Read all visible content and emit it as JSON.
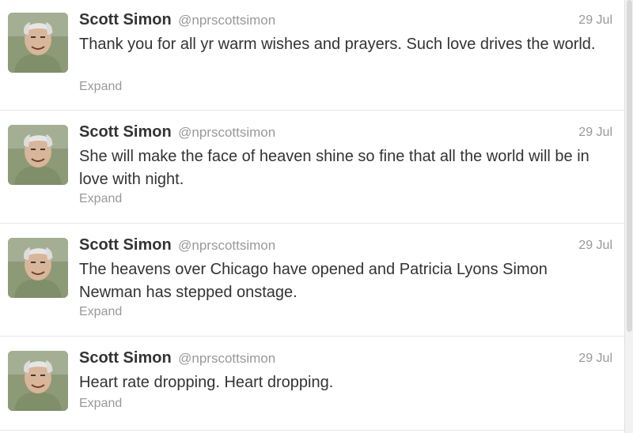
{
  "author": {
    "fullname": "Scott Simon",
    "username": "@nprscottsimon"
  },
  "tweets": [
    {
      "text": "Thank you for all yr warm wishes and prayers. Such love drives the world.",
      "time": "29 Jul",
      "expand_label": "Expand"
    },
    {
      "text": "She will make the face of heaven shine so fine that all the world will be in love with night.",
      "time": "29 Jul",
      "expand_label": "Expand"
    },
    {
      "text": "The heavens over Chicago have opened and Patricia Lyons Simon Newman has stepped onstage.",
      "time": "29 Jul",
      "expand_label": "Expand"
    },
    {
      "text": "Heart rate dropping. Heart dropping.",
      "time": "29 Jul",
      "expand_label": "Expand"
    }
  ],
  "colors": {
    "name": "#333333",
    "muted": "#999999",
    "divider": "#e6e6e6"
  },
  "icons": {
    "avatar": "profile-photo"
  }
}
